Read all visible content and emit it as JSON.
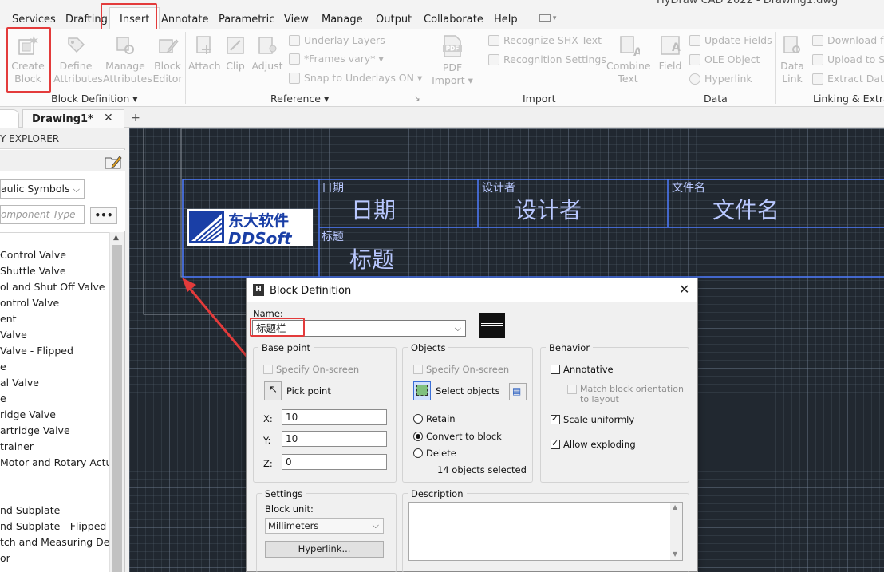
{
  "window": {
    "title_fragment": "HyDraw CAD 2022 - Drawing1.dwg"
  },
  "menu": {
    "tabs": [
      "Services",
      "Drafting",
      "Insert",
      "Annotate",
      "Parametric",
      "View",
      "Manage",
      "Output",
      "Collaborate",
      "Help"
    ],
    "active": "Insert"
  },
  "ribbon": {
    "block_definition": {
      "label": "Block Definition",
      "create_block": [
        "Create",
        "Block"
      ],
      "define_attributes": [
        "Define",
        "Attributes"
      ],
      "manage_attributes": [
        "Manage",
        "Attributes"
      ],
      "block_editor": [
        "Block",
        "Editor"
      ]
    },
    "reference": {
      "label": "Reference",
      "attach": "Attach",
      "clip": "Clip",
      "adjust": "Adjust",
      "underlay_layers": "Underlay Layers",
      "frames_vary": "*Frames vary*",
      "snap_to_underlays": "Snap to Underlays ON"
    },
    "import": {
      "label": "Import",
      "pdf_import": [
        "PDF",
        "Import"
      ],
      "pdf_icon_text": "PDF",
      "recognize_shx": "Recognize SHX Text",
      "recognition_settings": "Recognition Settings",
      "combine_text": [
        "Combine",
        "Text"
      ]
    },
    "data": {
      "label": "Data",
      "field": "Field",
      "update_fields": "Update Fields",
      "ole_object": "OLE Object",
      "hyperlink": "Hyperlink"
    },
    "linking": {
      "label": "Linking & Extrac",
      "data_link": [
        "Data",
        "Link"
      ],
      "download": "Download f",
      "upload": "Upload to S",
      "extract": "Extract Dat"
    }
  },
  "doc_tabs": {
    "active": "Drawing1*",
    "close": "✕",
    "add": "+"
  },
  "explorer": {
    "title": "Y EXPLORER",
    "category": "aulic Symbols",
    "search_placeholder": "omponent Type",
    "more_button": "•••",
    "items": [
      "Control Valve",
      "Shuttle Valve",
      "ol and Shut Off Valve",
      "ontrol Valve",
      "ent",
      "Valve",
      "Valve - Flipped",
      "e",
      "al Valve",
      "e",
      "ridge Valve",
      "artridge Valve",
      "trainer",
      "Motor and Rotary Actua",
      "",
      "",
      "nd Subplate",
      "nd Subplate - Flipped",
      "tch and Measuring Dev",
      "or"
    ]
  },
  "title_block": {
    "logo_cn": "东大软件",
    "logo_en": "DDSoft",
    "date_label": "日期",
    "date_value": "日期",
    "designer_label": "设计者",
    "designer_value": "设计者",
    "filename_label": "文件名",
    "filename_value": "文件名",
    "title_label": "标题",
    "title_value": "标题"
  },
  "dialog": {
    "title": "Block Definition",
    "close": "✕",
    "name_label": "Name:",
    "name_value": "标题栏",
    "base_point": {
      "title": "Base point",
      "specify": "Specify On-screen",
      "pick_point": "Pick point",
      "x_label": "X:",
      "x": "10",
      "y_label": "Y:",
      "y": "10",
      "z_label": "Z:",
      "z": "0"
    },
    "objects": {
      "title": "Objects",
      "specify": "Specify On-screen",
      "select_objects": "Select objects",
      "retain": "Retain",
      "convert": "Convert to block",
      "delete": "Delete",
      "count": "14 objects selected",
      "selected_option": "convert"
    },
    "behavior": {
      "title": "Behavior",
      "annotative": "Annotative",
      "annotative_checked": false,
      "match": [
        "Match block orientation",
        "to layout"
      ],
      "scale_uniformly": "Scale uniformly",
      "scale_uniformly_checked": true,
      "allow_exploding": "Allow exploding",
      "allow_exploding_checked": true
    },
    "settings": {
      "title": "Settings",
      "block_unit_label": "Block unit:",
      "block_unit": "Millimeters",
      "hyperlink_button": "Hyperlink..."
    },
    "description": {
      "title": "Description"
    }
  },
  "colors": {
    "canvas_bg": "#212830",
    "block_lines": "#4f7cff",
    "block_text": "#b9c8ff",
    "highlight": "#e33b3b",
    "logo_blue": "#1a3fa6"
  }
}
